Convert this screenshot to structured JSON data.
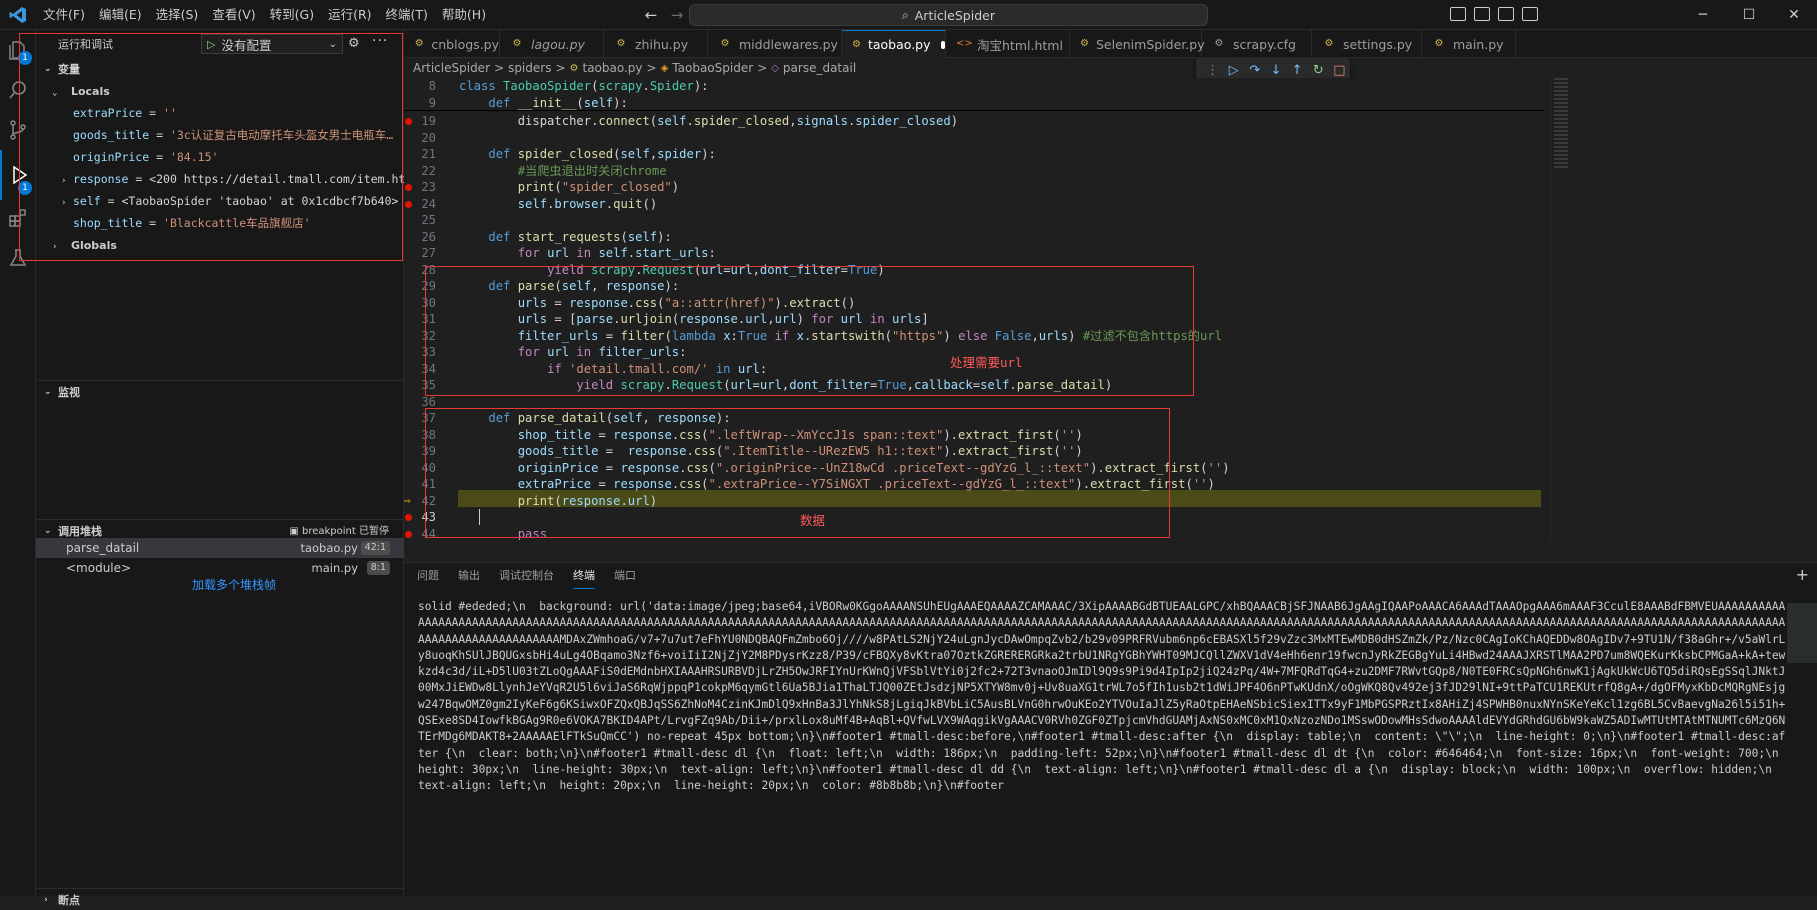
{
  "titlebar": {
    "menus": [
      "文件(F)",
      "编辑(E)",
      "选择(S)",
      "查看(V)",
      "转到(G)",
      "运行(R)",
      "终端(T)",
      "帮助(H)"
    ],
    "search": "ArticleSpider"
  },
  "activity": {
    "explorer_badge": "1",
    "debug_badge": "1"
  },
  "sidebar": {
    "title": "运行和调试",
    "run_config": "没有配置",
    "variables_title": "变量",
    "locals_label": "Locals",
    "globals_label": "Globals",
    "locals": [
      {
        "name": "extraPrice",
        "value": "''",
        "expandable": false
      },
      {
        "name": "goods_title",
        "value": "'3c认证复古电动摩托车头盔女男士电瓶车…",
        "expandable": false
      },
      {
        "name": "originPrice",
        "value": "'84.15'",
        "expandable": false
      },
      {
        "name": "response",
        "value": "<200 https://detail.tmall.com/item.htm?i…",
        "expandable": true
      },
      {
        "name": "self",
        "value": "<TaobaoSpider 'taobao' at 0x1cdbcf7b640>",
        "expandable": true
      },
      {
        "name": "shop_title",
        "value": "'Blackcattle车品旗舰店'",
        "expandable": false
      }
    ],
    "watch_title": "监视",
    "callstack_title": "调用堆栈",
    "callstack_status": "breakpoint 已暂停",
    "frames": [
      {
        "name": "parse_datail",
        "file": "taobao.py",
        "pos": "42:1"
      },
      {
        "name": "<module>",
        "file": "main.py",
        "pos": "8:1"
      }
    ],
    "load_more": "加载多个堆栈帧",
    "breakpoints_title": "断点"
  },
  "tabs": [
    {
      "label": "cnblogs.py",
      "italic": false,
      "icon": "python-icon"
    },
    {
      "label": "lagou.py",
      "italic": true,
      "icon": "python-icon"
    },
    {
      "label": "zhihu.py",
      "italic": false,
      "icon": "python-icon"
    },
    {
      "label": "middlewares.py",
      "italic": false,
      "icon": "python-icon"
    },
    {
      "label": "taobao.py",
      "italic": false,
      "icon": "python-icon",
      "active": true,
      "dirty": true
    },
    {
      "label": "淘宝html.html",
      "italic": false,
      "icon": "html-icon"
    },
    {
      "label": "SelenimSpider.py",
      "italic": false,
      "icon": "python-icon"
    },
    {
      "label": "scrapy.cfg",
      "italic": false,
      "icon": "gear-icon"
    },
    {
      "label": "settings.py",
      "italic": false,
      "icon": "python-icon"
    },
    {
      "label": "main.py",
      "italic": false,
      "icon": "python-icon"
    }
  ],
  "breadcrumb": [
    "ArticleSpider",
    ">",
    "spiders",
    ">",
    "taobao.py",
    ">",
    "TaobaoSpider",
    ">",
    "parse_datail"
  ],
  "annotations": {
    "url_box": "处理需要url",
    "data_box": "数据"
  },
  "panel": {
    "tabs": [
      "问题",
      "输出",
      "调试控制台",
      "终端",
      "端口"
    ],
    "active_tab": "终端",
    "terminal_text": "solid #ededed;\\n  background: url('data:image/jpeg;base64,iVBORw0KGgoAAAANSUhEUgAAAEQAAAAZCAMAAAC/3XipAAAABGdBTUEAALGPC/xhBQAAACBjSFJNAAB6JgAAgIQAAPoAAACA6AAAdTAAAOpgAAA6mAAAF3CculE8AAABdFBMVEUAAAAAAAAAAAAAAAAAAAAAAAAAAAAAAAAAAAAAAAAAAAAAAAAAAAAAAAAAAAAAAAAAAAAAAAAAAAAAAAAAAAAAAAAAAAAAAAAAAAAAAAAAAAAAAAAAAAAAAAAAAAAAAAAAAAAAAAAAAAAAAAAAAAAAAAAAAAAAAAAAAAAAAAAAAAAAAAAAAAAAAAAAAAAAAAAAAAAAAAAAAAAAAAAAAAAAAAAAAAAAAAAAAAAAAAAAAMDAxZWmhoaG/v7+7u7ut7eFhYU0NDQBAQFmZmbo6Oj////w8PAtLS2NjY24uLgnJycDAwOmpqZvb2/b29v09PRFRVubm6np6cEBASXl5f29vZzc3MxMTEwMDB0dHSZmZk/Pz/Nzc0CAgIoKChAQEDDw8OAgIDv7+9TU1N/f38aGhr+/v5aWlrLy8uoqKhSUlJBQUGxsbHi4uLg4OBqamo3Nzf6+voiIiI2NjZjY2M8PDysrKzz8/P39/cFBQXy8vKtra07OztkZGRERERGRka2trbU1NRgYGBhYWHT09MJCQllZWXV1dV4eHh6enr19fwcnJyRkZEGBgYuLi4HBwd24AAAJXRSTlMAA2PD7um8WQEKurKksbCPMGaA+kA+tewkzd4c3d/iL+D5lU03tZLoQgAAAFiS0dEMdnbHXIAAAHRSURBVDjLrZH5OwJRFIYnUrKWnQjVFSblVtYi0j2fc2+72T3vnaoOJmIDl9Q9s9Pi9d4IpIp2jiQ24zPq/4W+7MFQRdTqG4+zu2DMF7RWvtGQp8/N0TE0FRCsQpNGh6nwK1jAgkUkWcU6TQ5diRQsEgSSqlJNktJ00MxJiEWDw8LlynhJeYVqR2U5l6viJaS6RqWjppqP1cokpM6qymGtl6Ua5BJia1ThaLTJQ00ZEtJsdzjNP5XTYW8mv0j+Uv8uaXG1trWL7o5fIh1usb2t1dWiJPF4O6nPTwKUdnX/oOgWKQ8Qv492ej3fJD29lNI+9ttPaTCU1REKUtrfQ8gA+/dgOFMyxKbDcMQRgNEsjgw247BqwOMZ0gm2IyKeF6g6KSiwxOFZQxQBJqSS6ZhNoM4CzinKJmDlQ9xHnBa3JlYhNkS8jLgiqJkBVbLiC5AusBLVnG0hrwOuKEo2YTVOuIaJlZ5yRaOtpEHAeNSbicSiexITTx9yF1MbPGSPRztIx8AHiZj4SPWHB0nuxNYnSKeYeKcl1zg6BL5CvBaevgNa26l5i51h+QSExe8SD4IowfkBGAg9R0e6VOKA7BKID4APt/LrvgFZq9Ab/Dii+/prxlLox8uMf4B+AqBl+QVfwLVX9WAqgikVgAAACV0RVh0ZGF0ZTpjcmVhdGUAMjAxNS0xMC0xM1QxNzozNDo1MSswODowMHsSdwoAAAAldEVYdGRhdGU6bW9kaWZ5ADIwMTUtMTAtMTNUMTc6MzQ6NTErMDg6MDAKT8+2AAAAAElFTkSuQmCC') no-repeat 45px bottom;\\n}\\n#footer1 #tmall-desc:before,\\n#footer1 #tmall-desc:after {\\n  display: table;\\n  content: \\\"\\\";\\n  line-height: 0;\\n}\\n#footer1 #tmall-desc:after {\\n  clear: both;\\n}\\n#footer1 #tmall-desc dl {\\n  float: left;\\n  width: 186px;\\n  padding-left: 52px;\\n}\\n#footer1 #tmall-desc dl dt {\\n  color: #646464;\\n  font-size: 16px;\\n  font-weight: 700;\\n  height: 30px;\\n  line-height: 30px;\\n  text-align: left;\\n}\\n#footer1 #tmall-desc dl dd {\\n  text-align: left;\\n}\\n#footer1 #tmall-desc dl a {\\n  display: block;\\n  width: 100px;\\n  overflow: hidden;\\n  text-align: left;\\n  height: 20px;\\n  line-height: 20px;\\n  color: #8b8b8b;\\n}\\n#footer"
  },
  "code_lines": [
    {
      "n": "8"
    },
    {
      "n": "9"
    },
    {
      "n": "19"
    },
    {
      "n": "20"
    },
    {
      "n": "21"
    },
    {
      "n": "22"
    },
    {
      "n": "23"
    },
    {
      "n": "24"
    },
    {
      "n": "25"
    },
    {
      "n": "26"
    },
    {
      "n": "27"
    },
    {
      "n": "28"
    },
    {
      "n": "29"
    },
    {
      "n": "30"
    },
    {
      "n": "31"
    },
    {
      "n": "32"
    },
    {
      "n": "33"
    },
    {
      "n": "34"
    },
    {
      "n": "35"
    },
    {
      "n": "36"
    },
    {
      "n": "37"
    },
    {
      "n": "38"
    },
    {
      "n": "39"
    },
    {
      "n": "40"
    },
    {
      "n": "41"
    },
    {
      "n": "42"
    },
    {
      "n": "43"
    },
    {
      "n": "44"
    }
  ],
  "code": {
    "l8": [
      "class ",
      "TaobaoSpider",
      "(",
      "scrapy",
      ".",
      "Spider",
      "):"
    ],
    "l9": [
      "def ",
      "__init__",
      "(",
      "self",
      "):"
    ],
    "l19": [
      "dispatcher",
      ".",
      "connect",
      "(",
      "self",
      ".",
      "spider_closed",
      ",",
      "signals",
      ".",
      "spider_closed",
      ")"
    ],
    "l21": [
      "def ",
      "spider_closed",
      "(",
      "self",
      ",",
      "spider",
      "):"
    ],
    "l22": "#当爬虫退出时关闭chrome",
    "l23": [
      "print",
      "(",
      "\"spider_closed\"",
      ")"
    ],
    "l24": [
      "self",
      ".",
      "browser",
      ".",
      "quit",
      "()"
    ],
    "l26": [
      "def ",
      "start_requests",
      "(",
      "self",
      "):"
    ],
    "l27": [
      "for ",
      "url ",
      "in ",
      "self",
      ".",
      "start_urls",
      ":"
    ],
    "l28": [
      "yield ",
      "scrapy",
      ".",
      "Request",
      "(",
      "url",
      "=",
      "url",
      ",",
      "dont_filter",
      "=",
      "True",
      ")"
    ],
    "l29": [
      "def ",
      "parse",
      "(",
      "self",
      ", ",
      "response",
      "):"
    ],
    "l30": [
      "urls ",
      "= ",
      "response",
      ".",
      "css",
      "(",
      "\"a::attr(href)\"",
      ").",
      "extract",
      "()"
    ],
    "l31": [
      "urls ",
      "= ",
      "[",
      "parse",
      ".",
      "urljoin",
      "(",
      "response",
      ".",
      "url",
      ",",
      "url",
      ") ",
      "for ",
      "url ",
      "in ",
      "urls",
      "]"
    ],
    "l32": [
      "filter_urls ",
      "= ",
      "filter",
      "(",
      "lambda ",
      "x",
      ":",
      "True ",
      "if ",
      "x",
      ".",
      "startswith",
      "(",
      "\"https\"",
      ") ",
      "else ",
      "False",
      ",",
      "urls",
      ") ",
      "#过滤不包含https的url"
    ],
    "l33": [
      "for ",
      "url ",
      "in ",
      "filter_urls",
      ":"
    ],
    "l34": [
      "if ",
      "'detail.tmall.com/' ",
      "in ",
      "url",
      ":"
    ],
    "l35": [
      "yield ",
      "scrapy",
      ".",
      "Request",
      "(",
      "url",
      "=",
      "url",
      ",",
      "dont_filter",
      "=",
      "True",
      ",",
      "callback",
      "=",
      "self",
      ".",
      "parse_datail",
      ")"
    ],
    "l37": [
      "def ",
      "parse_datail",
      "(",
      "self",
      ", ",
      "response",
      "):"
    ],
    "l38": [
      "shop_title ",
      "= ",
      "response",
      ".",
      "css",
      "(",
      "\".leftWrap--XmYccJ1s span::text\"",
      ").",
      "extract_first",
      "(",
      "''",
      ")"
    ],
    "l39": [
      "goods_title ",
      "=  ",
      "response",
      ".",
      "css",
      "(",
      "\".ItemTitle--URezEW5 h1::text\"",
      ").",
      "extract_first",
      "(",
      "''",
      ")"
    ],
    "l40": [
      "originPrice ",
      "= ",
      "response",
      ".",
      "css",
      "(",
      "\".originPrice--UnZ18wCd .priceText--gdYzG_l_::text\"",
      ").",
      "extract_first",
      "(",
      "''",
      ")"
    ],
    "l41": [
      "extraPrice ",
      "= ",
      "response",
      ".",
      "css",
      "(",
      "\".extraPrice--Y7SiNGXT .priceText--gdYzG_l_::text\"",
      ").",
      "extract_first",
      "(",
      "''",
      ")"
    ],
    "l42": [
      "print",
      "(",
      "response",
      ".",
      "url",
      ")"
    ],
    "l44": "pass"
  }
}
